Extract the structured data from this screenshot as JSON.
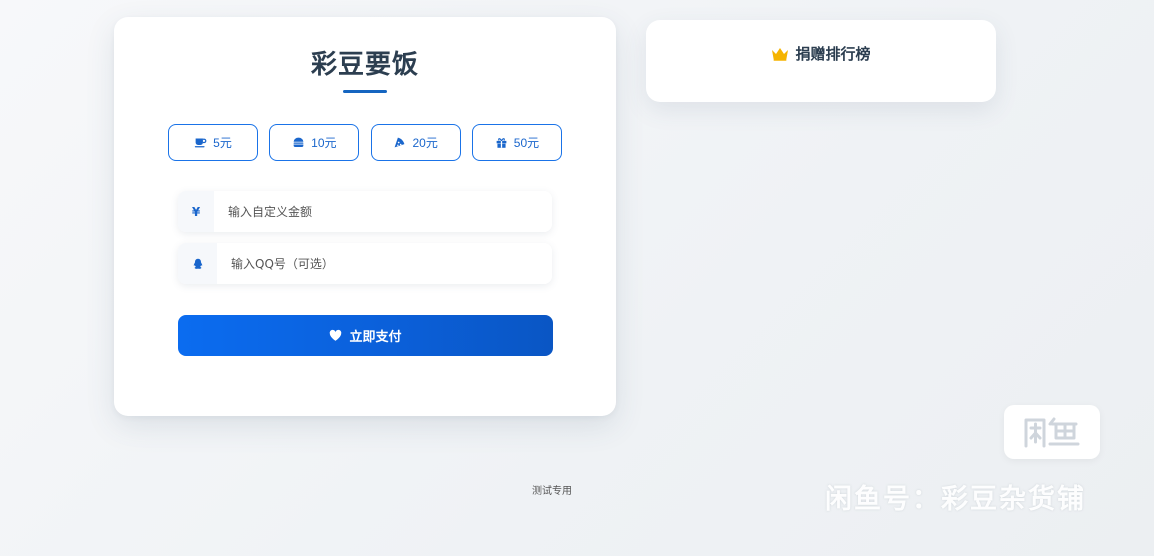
{
  "main": {
    "title": "彩豆要饭",
    "amount_buttons": [
      {
        "label": "5元",
        "icon": "coffee-icon"
      },
      {
        "label": "10元",
        "icon": "burger-icon"
      },
      {
        "label": "20元",
        "icon": "pizza-icon"
      },
      {
        "label": "50元",
        "icon": "gift-icon"
      }
    ],
    "custom_amount": {
      "prefix": "¥",
      "placeholder": "输入自定义金额",
      "value": ""
    },
    "qq": {
      "icon": "qq-icon",
      "placeholder": "输入QQ号（可选）",
      "value": ""
    },
    "pay_button": {
      "label": "立即支付",
      "icon": "heart-icon"
    }
  },
  "ranking": {
    "title": "捐赠排行榜",
    "icon": "crown-icon"
  },
  "footer": {
    "note": "测试专用"
  },
  "watermark": {
    "text": "闲鱼号：彩豆杂货铺",
    "logo_icon": "xianyu-logo-icon"
  },
  "colors": {
    "accent": "#1a73e8",
    "title": "#2c3e50",
    "crown": "#f5b400"
  }
}
